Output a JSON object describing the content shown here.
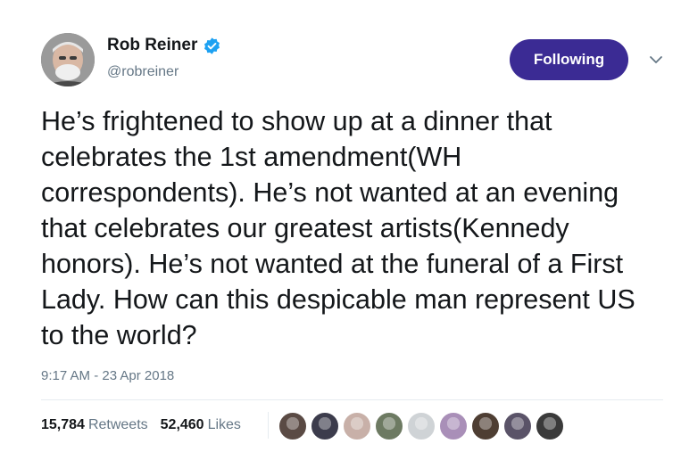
{
  "author": {
    "name": "Rob Reiner",
    "handle": "@robreiner",
    "verified": true,
    "avatar_icon": "avatar-photo"
  },
  "follow_button": {
    "label": "Following",
    "color": "#3b2b94"
  },
  "tweet": {
    "text": "He’s frightened to show up at a dinner that celebrates the 1st amendment(WH correspondents). He’s not wanted at an evening that celebrates our greatest artists(Kennedy honors). He’s not wanted at the funeral of a First Lady. How can this despicable man represent US to the world?",
    "timestamp": "9:17 AM - 23 Apr 2018"
  },
  "stats": {
    "retweets_count": "15,784",
    "retweets_label": "Retweets",
    "likes_count": "52,460",
    "likes_label": "Likes"
  },
  "likers": [
    {
      "color": "#5a4a44"
    },
    {
      "color": "#3c3c4c"
    },
    {
      "color": "#c8b0a8"
    },
    {
      "color": "#6d7a62"
    },
    {
      "color": "#cfd3d6"
    },
    {
      "color": "#a98fb8"
    },
    {
      "color": "#4e3e33"
    },
    {
      "color": "#5a5368"
    },
    {
      "color": "#3a3a3a"
    }
  ],
  "colors": {
    "verified_badge": "#1da1f2",
    "secondary_text": "#657786"
  }
}
